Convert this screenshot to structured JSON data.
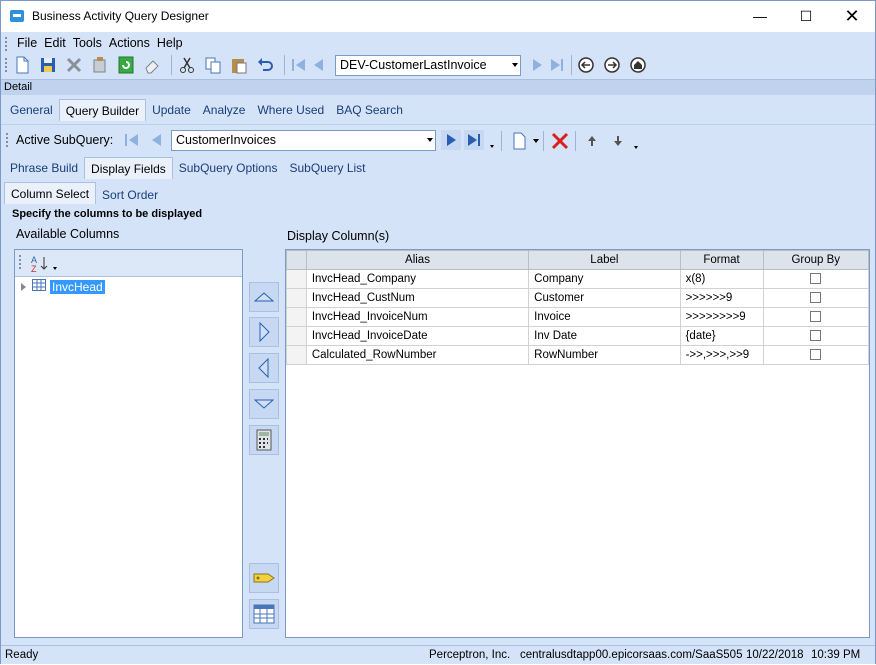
{
  "window": {
    "title": "Business Activity Query Designer"
  },
  "menu": [
    "File",
    "Edit",
    "Tools",
    "Actions",
    "Help"
  ],
  "toolbar": {
    "query_combo": "DEV-CustomerLastInvoice"
  },
  "detail_label": "Detail",
  "main_tabs": [
    "General",
    "Query Builder",
    "Update",
    "Analyze",
    "Where Used",
    "BAQ Search"
  ],
  "subquery": {
    "label": "Active SubQuery:",
    "value": "CustomerInvoices"
  },
  "builder_tabs": [
    "Phrase Build",
    "Display Fields",
    "SubQuery Options",
    "SubQuery List"
  ],
  "column_tabs": [
    "Column Select",
    "Sort Order"
  ],
  "instruction": "Specify the columns to be displayed",
  "available_columns": {
    "label": "Available Columns",
    "tree_item": "InvcHead"
  },
  "display_columns": {
    "label": "Display Column(s)",
    "headers": [
      "Alias",
      "Label",
      "Format",
      "Group By"
    ],
    "rows": [
      {
        "alias": "InvcHead_Company",
        "label": "Company",
        "format": "x(8)"
      },
      {
        "alias": "InvcHead_CustNum",
        "label": "Customer",
        "format": ">>>>>>9"
      },
      {
        "alias": "InvcHead_InvoiceNum",
        "label": "Invoice",
        "format": ">>>>>>>>9"
      },
      {
        "alias": "InvcHead_InvoiceDate",
        "label": "Inv Date",
        "format": "{date}"
      },
      {
        "alias": "Calculated_RowNumber",
        "label": "RowNumber",
        "format": "->>,>>>,>>9"
      }
    ]
  },
  "status": {
    "state": "Ready",
    "company": "Perceptron, Inc.",
    "server": "centralusdtapp00.epicorsaas.com/SaaS505",
    "date": "10/22/2018",
    "time": "10:39 PM"
  },
  "colors": {
    "accent": "#d4e3f7",
    "selection": "#3399ff",
    "delete": "#d92020"
  }
}
